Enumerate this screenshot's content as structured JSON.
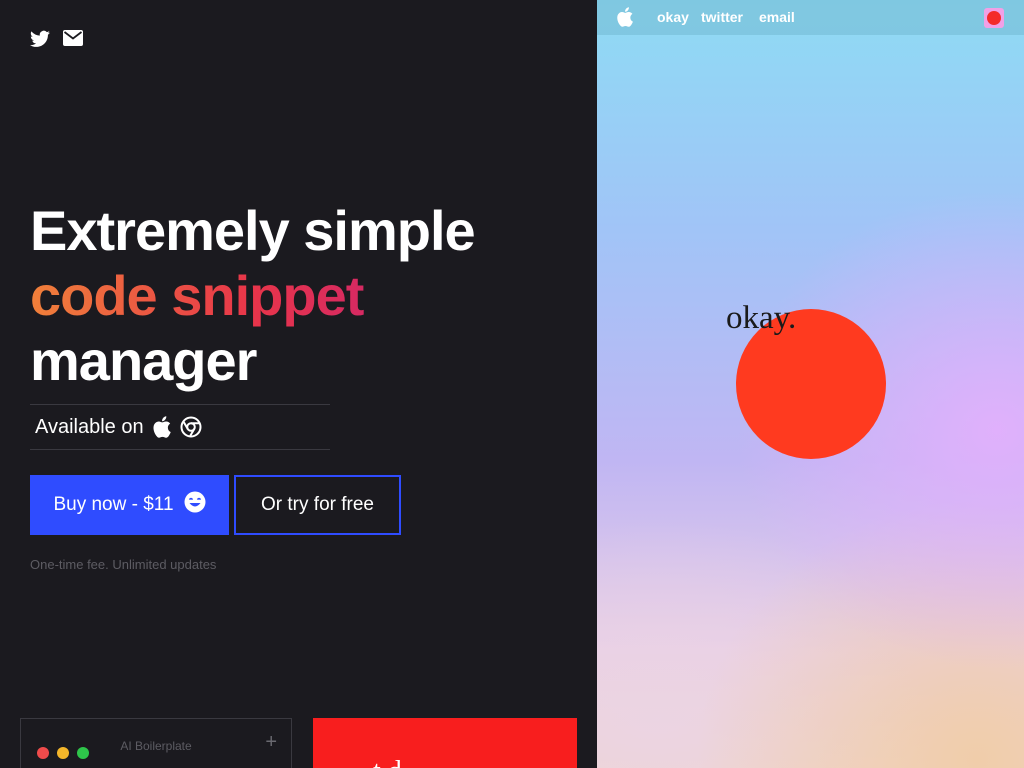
{
  "socials": {
    "twitter_icon": "twitter-icon",
    "email_icon": "mail-icon"
  },
  "hero": {
    "line1": "Extremely simple",
    "line2": "code snippet",
    "line3": "manager"
  },
  "available": {
    "label": "Available on",
    "platforms": [
      "apple-icon",
      "chrome-icon"
    ]
  },
  "cta": {
    "buy_label": "Buy now - $11",
    "buy_icon": "smile-icon",
    "free_label": "Or try for free",
    "fee_note": "One-time fee. Unlimited updates"
  },
  "cards": {
    "dark_title": "AI Boilerplate",
    "dark_plus": "+",
    "red_text": "t        d"
  },
  "preview": {
    "menubar": {
      "app_icon": "apple-icon",
      "items": [
        "okay",
        "twitter",
        "email"
      ]
    },
    "wordmark": "okay."
  },
  "colors": {
    "accent": "#2f4cff",
    "sun": "#ff3a1f",
    "bg": "#1b1a1f"
  }
}
